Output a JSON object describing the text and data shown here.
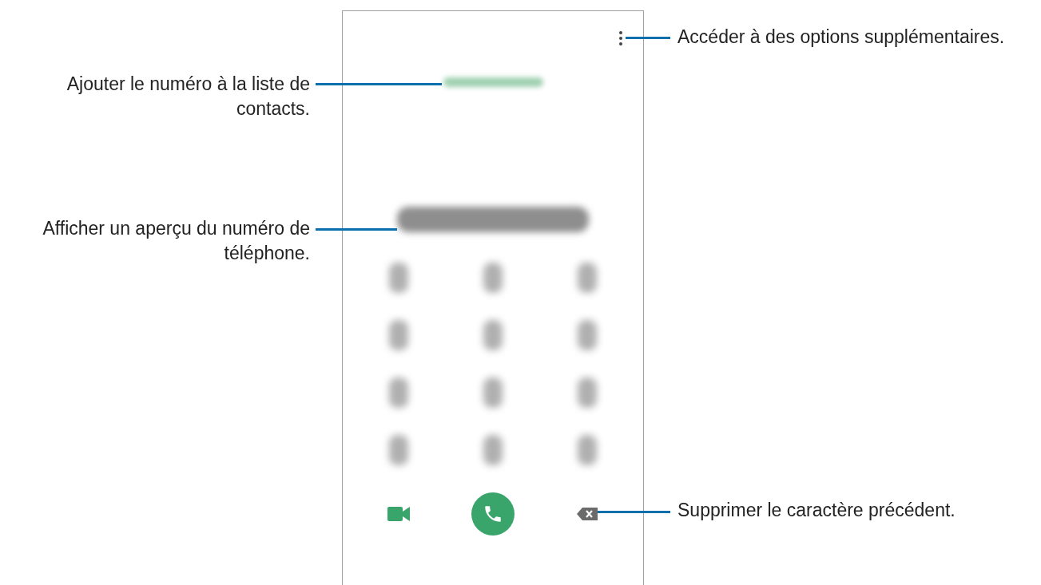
{
  "left_callouts": [
    {
      "text": "Ajouter le numéro à la liste de contacts."
    },
    {
      "text": "Afficher un aperçu du numéro de téléphone."
    }
  ],
  "right_callouts": [
    {
      "text": "Accéder à des options supplémentaires."
    },
    {
      "text": "Supprimer le caractère précédent."
    }
  ]
}
